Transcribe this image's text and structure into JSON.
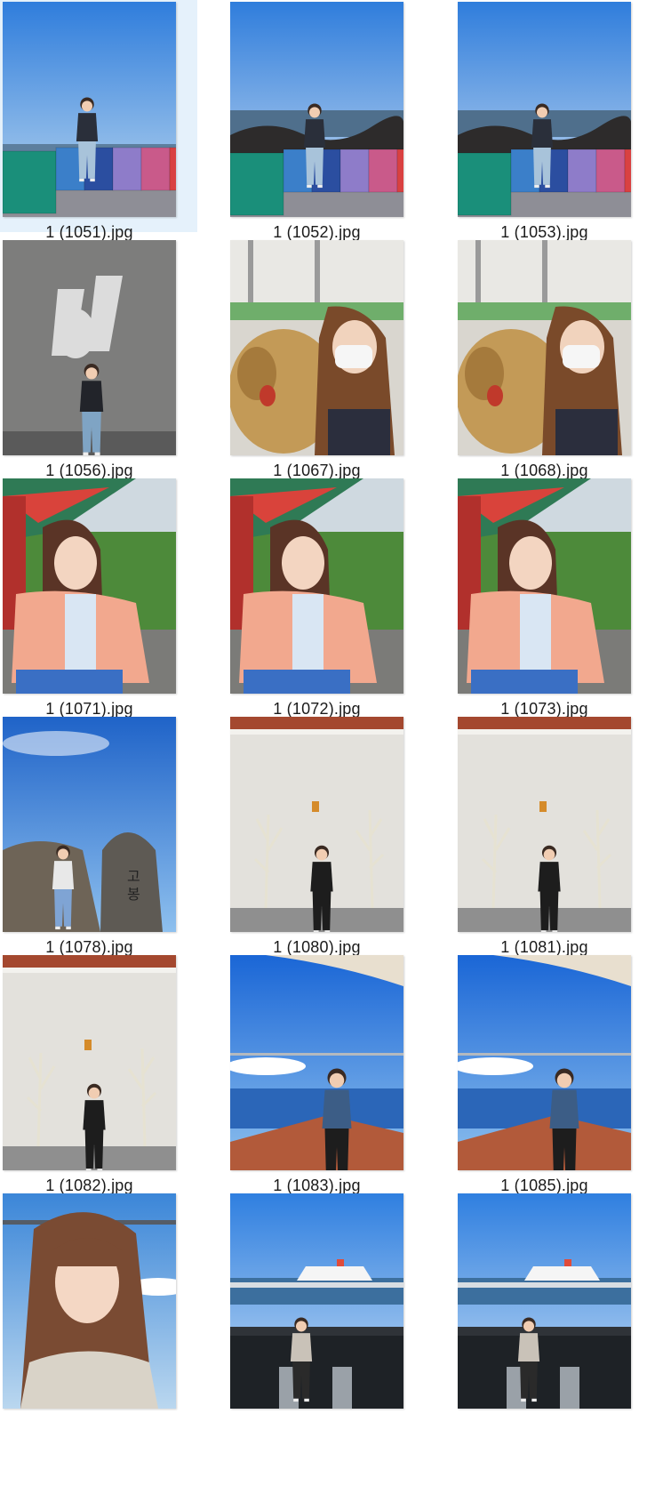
{
  "files": [
    {
      "name": "1 (1051).jpg",
      "selected": true,
      "scene": "sea-blocks"
    },
    {
      "name": "1 (1052).jpg",
      "selected": false,
      "scene": "sea-blocks-rocks"
    },
    {
      "name": "1 (1053).jpg",
      "selected": false,
      "scene": "sea-blocks-rocks"
    },
    {
      "name": "1 (1056).jpg",
      "selected": false,
      "scene": "concrete-wall-d"
    },
    {
      "name": "1 (1067).jpg",
      "selected": false,
      "scene": "store-dog-plush"
    },
    {
      "name": "1 (1068).jpg",
      "selected": false,
      "scene": "store-dog-plush"
    },
    {
      "name": "1 (1071).jpg",
      "selected": false,
      "scene": "temple-forest"
    },
    {
      "name": "1 (1072).jpg",
      "selected": false,
      "scene": "temple-forest"
    },
    {
      "name": "1 (1073).jpg",
      "selected": false,
      "scene": "temple-forest"
    },
    {
      "name": "1 (1078).jpg",
      "selected": false,
      "scene": "sky-stone"
    },
    {
      "name": "1 (1080).jpg",
      "selected": false,
      "scene": "white-wall-trees"
    },
    {
      "name": "1 (1081).jpg",
      "selected": false,
      "scene": "white-wall-trees"
    },
    {
      "name": "1 (1082).jpg",
      "selected": false,
      "scene": "white-wall-trees"
    },
    {
      "name": "1 (1083).jpg",
      "selected": false,
      "scene": "rooftop-sea"
    },
    {
      "name": "1 (1085).jpg",
      "selected": false,
      "scene": "rooftop-sea"
    },
    {
      "name": "",
      "selected": false,
      "scene": "portrait-sky"
    },
    {
      "name": "",
      "selected": false,
      "scene": "harbor-ship"
    },
    {
      "name": "",
      "selected": false,
      "scene": "harbor-ship"
    }
  ]
}
